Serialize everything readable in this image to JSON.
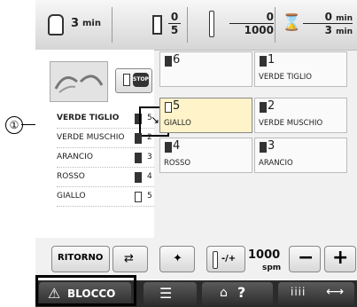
{
  "callout_label": "①",
  "status": {
    "time_value": "3",
    "time_unit": "min",
    "spool_num": "0",
    "spool_den": "5",
    "stitch_num": "0",
    "stitch_den": "1000",
    "remain_num_value": "0",
    "remain_num_unit": "min",
    "remain_den_value": "3",
    "remain_den_unit": "min"
  },
  "stop_label": "STOP",
  "color_list": [
    {
      "name": "VERDE TIGLIO",
      "number": "5"
    },
    {
      "name": "VERDE MUSCHIO",
      "number": "2"
    },
    {
      "name": "ARANCIO",
      "number": "3"
    },
    {
      "name": "ROSSO",
      "number": "4"
    },
    {
      "name": "GIALLO",
      "number": "5"
    }
  ],
  "spools": [
    {
      "number": "6",
      "name": ""
    },
    {
      "number": "1",
      "name": "VERDE TIGLIO"
    },
    {
      "number": "5",
      "name": "GIALLO"
    },
    {
      "number": "2",
      "name": "VERDE MUSCHIO"
    },
    {
      "number": "4",
      "name": "ROSSO"
    },
    {
      "number": "3",
      "name": "ARANCIO"
    }
  ],
  "controls": {
    "back_label": "RITORNO",
    "plusminus_label": "-/+",
    "speed_value": "1000",
    "speed_unit": "spm",
    "minus_label": "−",
    "plus_label": "+"
  },
  "tabs": {
    "lock_label": "BLOCCO",
    "help_label": "?",
    "arrows_label": "⟷"
  },
  "icons": [
    "hand-time-icon",
    "spool-icon",
    "needle-icon",
    "hourglass-icon",
    "stop-icon",
    "swap-spool-icon",
    "spool-pin-icon",
    "needle-plusminus-icon",
    "warning-icon",
    "list-icon",
    "machine-help-icon",
    "thread-arrows-icon"
  ]
}
